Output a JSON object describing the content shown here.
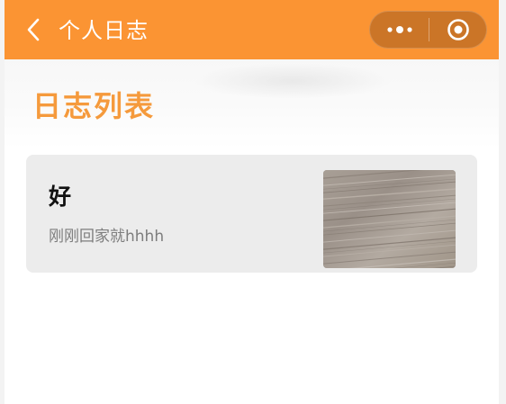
{
  "navbar": {
    "title": "个人日志",
    "back_icon": "chevron-left-icon",
    "more_icon": "more-dots-icon",
    "close_icon": "target-circle-icon",
    "background_color": "#fb9433"
  },
  "section": {
    "heading": "日志列表",
    "heading_color": "#f59a3c"
  },
  "logs": [
    {
      "title": "好",
      "content": "刚刚回家就hhhh",
      "thumbnail": "wood-texture-image"
    }
  ]
}
